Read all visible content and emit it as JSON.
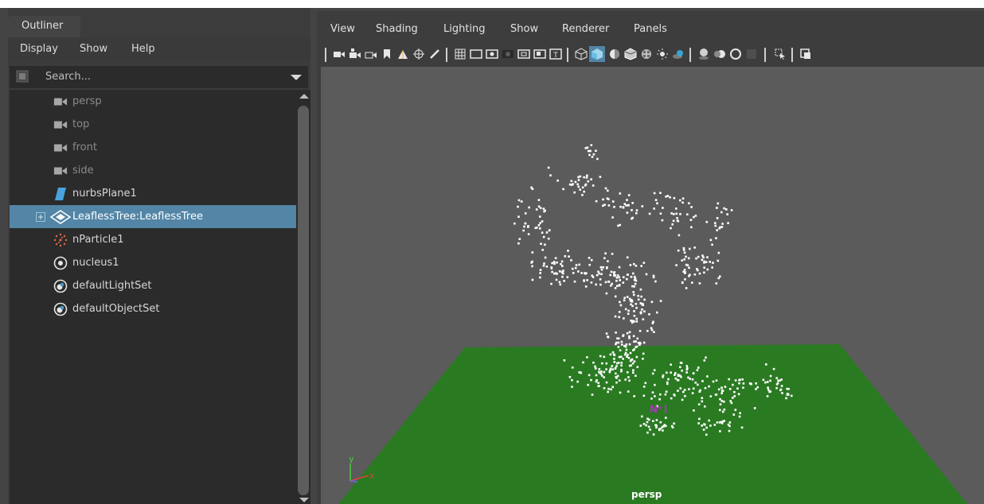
{
  "outliner": {
    "tab_label": "Outliner",
    "menu": [
      "Display",
      "Show",
      "Help"
    ],
    "search": {
      "placeholder": "Search..."
    },
    "items": [
      {
        "label": "persp",
        "icon": "camera-icon",
        "dim": true
      },
      {
        "label": "top",
        "icon": "camera-icon",
        "dim": true
      },
      {
        "label": "front",
        "icon": "camera-icon",
        "dim": true
      },
      {
        "label": "side",
        "icon": "camera-icon",
        "dim": true
      },
      {
        "label": "nurbsPlane1",
        "icon": "nurbs-plane-icon",
        "dim": false
      },
      {
        "label": "LeaflessTree:LeaflessTree",
        "icon": "reference-node-icon",
        "dim": false,
        "selected": true,
        "expandable": true
      },
      {
        "label": "nParticle1",
        "icon": "nparticle-icon",
        "dim": false
      },
      {
        "label": "nucleus1",
        "icon": "nucleus-icon",
        "dim": false
      },
      {
        "label": "defaultLightSet",
        "icon": "set-icon",
        "dim": false
      },
      {
        "label": "defaultObjectSet",
        "icon": "set-icon",
        "dim": false
      }
    ]
  },
  "viewport": {
    "menu": [
      "View",
      "Shading",
      "Lighting",
      "Show",
      "Renderer",
      "Panels"
    ],
    "camera_label": "persp",
    "axis_labels": {
      "y": "y",
      "x": "x"
    },
    "colors": {
      "background": "#5b5b5b",
      "ground": "#2a7a22",
      "particles": "#ffffff",
      "nucleus_marker": "#b42cc8",
      "selection": "#5285a6"
    }
  }
}
